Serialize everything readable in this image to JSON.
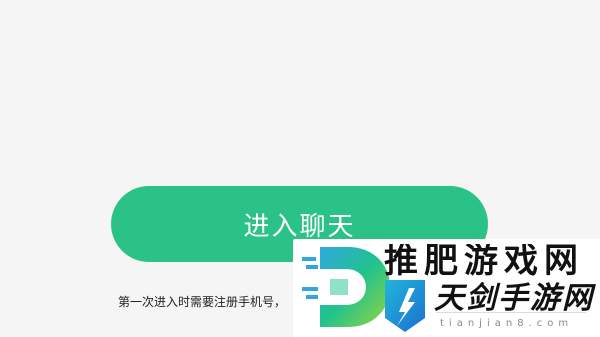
{
  "colors": {
    "primary": "#2bc287",
    "background": "#f5f5f5"
  },
  "main": {
    "enter_button_label": "进入聊天",
    "notice_text": "第一次进入时需要注册手机号，"
  },
  "watermark": {
    "title": "推肥游戏网",
    "name": "天剑手游网",
    "domain": "tianjian8.com",
    "logo_icon": "site-logo-icon",
    "badge_icon": "sword-badge-icon"
  }
}
